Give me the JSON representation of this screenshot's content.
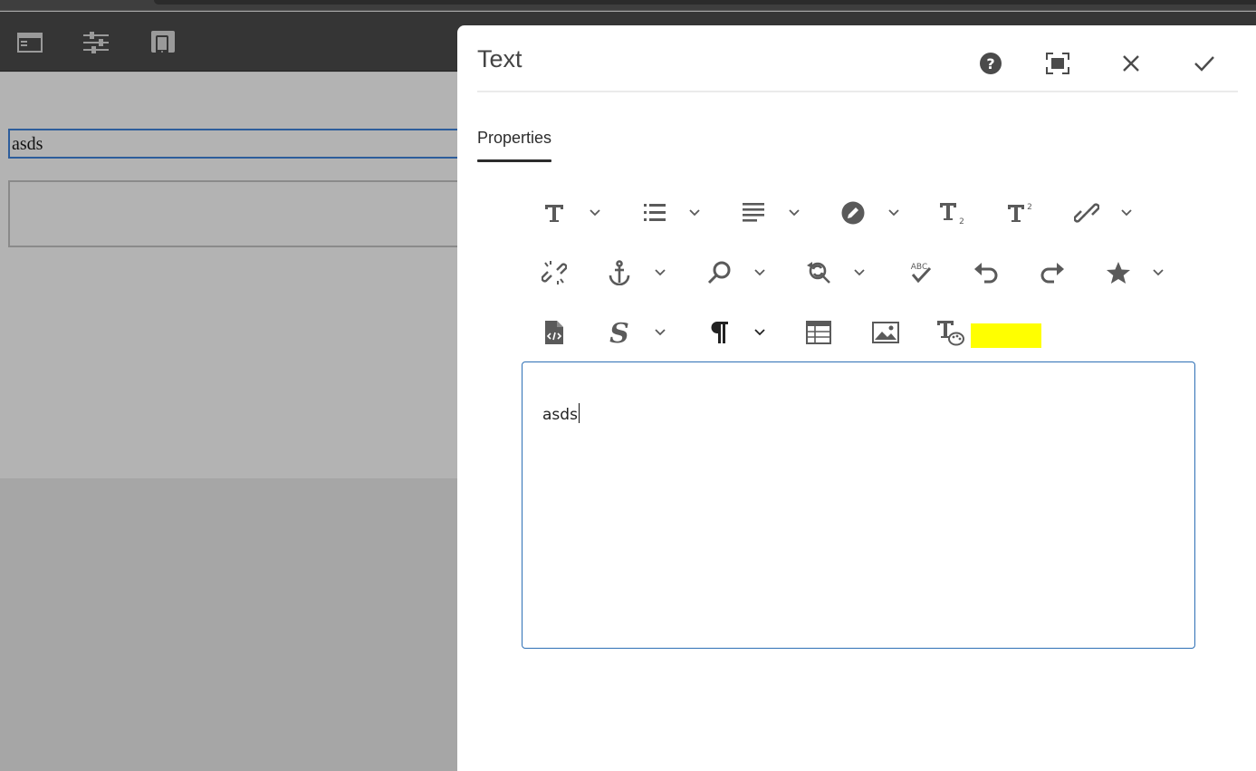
{
  "canvas": {
    "text_component_value": "asds"
  },
  "editor_toolbar": {
    "icons": [
      "side-panel-icon",
      "page-properties-icon",
      "emulator-icon"
    ]
  },
  "dialog": {
    "title": "Text",
    "actions": [
      "help-icon",
      "fullscreen-icon",
      "close-icon",
      "done-icon"
    ],
    "tabs": [
      {
        "label": "Properties",
        "active": true
      }
    ],
    "rte_toolbar": {
      "row1": [
        "format",
        "lists",
        "justify",
        "edit",
        "subscript",
        "superscript",
        "link"
      ],
      "row2": [
        "unlink",
        "anchor",
        "find",
        "find-replace",
        "spellcheck",
        "undo",
        "redo",
        "special-characters"
      ],
      "row3": [
        "source-edit",
        "styles",
        "paragraph-format",
        "table",
        "image",
        "text-color"
      ]
    },
    "editor": {
      "content": "asds"
    }
  },
  "colors": {
    "highlight": "#ffff00",
    "focus_border": "#2d6fb5",
    "selection_outline": "#2d5d9b"
  }
}
